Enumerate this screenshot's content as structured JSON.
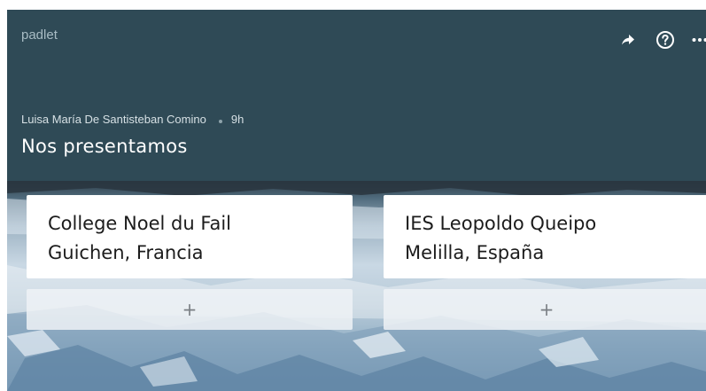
{
  "header": {
    "logo": "padlet",
    "author": "Luisa María De Santisteban Comino",
    "time": "9h",
    "title": "Nos presentamos",
    "icons": [
      "share-icon",
      "help-icon",
      "more-icon"
    ]
  },
  "columns": [
    {
      "line1": "College Noel du Fail",
      "line2": "Guichen, Francia",
      "add": "+"
    },
    {
      "line1": "IES Leopoldo Queipo",
      "line2": "Melilla, España",
      "add": "+"
    }
  ],
  "colors": {
    "header_bg": "#2f4a56",
    "header_text": "#ffffff",
    "logo": "#a8bcc4"
  }
}
